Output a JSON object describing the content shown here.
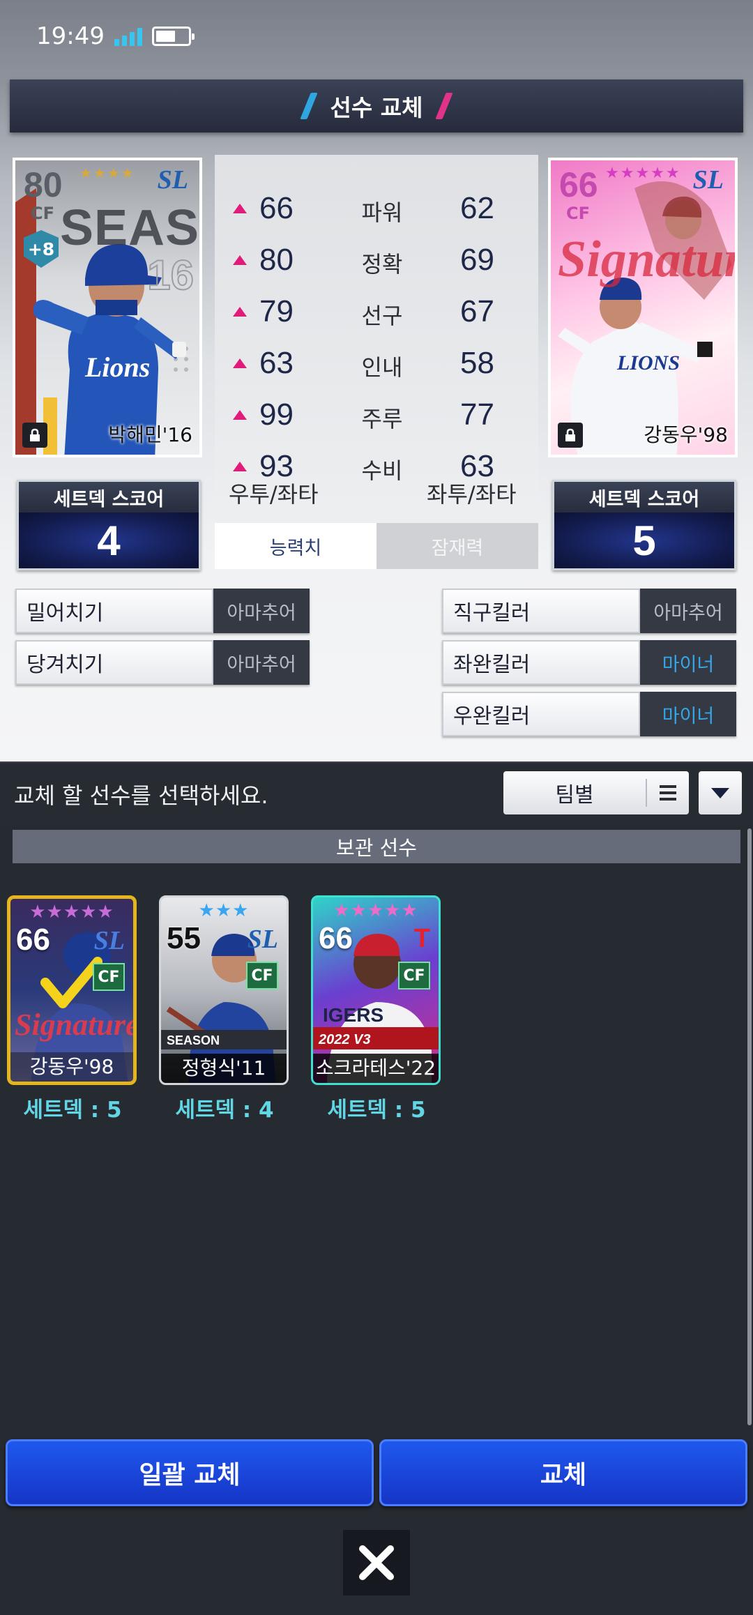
{
  "status_bar": {
    "time": "19:49"
  },
  "title": "선수 교체",
  "current_player": {
    "overall": "80",
    "position": "CF",
    "stars": "★★★★",
    "team_logo": "SL",
    "card_theme": "SEASON",
    "jersey_number": "16",
    "upgrade": "+8",
    "name": "박해민'16",
    "lock_icon": "lock-icon"
  },
  "target_player": {
    "overall": "66",
    "position": "CF",
    "stars": "★★★★★",
    "team_logo": "SL",
    "name": "강동우'98",
    "lock_icon": "lock-icon"
  },
  "stats": [
    {
      "label": "파워",
      "left": "66",
      "right": "62"
    },
    {
      "label": "정확",
      "left": "80",
      "right": "69"
    },
    {
      "label": "선구",
      "left": "79",
      "right": "67"
    },
    {
      "label": "인내",
      "left": "63",
      "right": "58"
    },
    {
      "label": "주루",
      "left": "99",
      "right": "77"
    },
    {
      "label": "수비",
      "left": "93",
      "right": "63"
    }
  ],
  "handedness": {
    "left": "우투/좌타",
    "right": "좌투/좌타"
  },
  "tabs": {
    "ability": "능력치",
    "potential": "잠재력"
  },
  "setdeck": {
    "label": "세트덱 스코어",
    "left_score": "4",
    "right_score": "5"
  },
  "left_skills": [
    {
      "name": "밀어치기",
      "level": "아마추어"
    },
    {
      "name": "당겨치기",
      "level": "아마추어"
    }
  ],
  "right_skills": [
    {
      "name": "직구킬러",
      "level": "아마추어"
    },
    {
      "name": "좌완킬러",
      "level": "마이너"
    },
    {
      "name": "우완킬러",
      "level": "마이너"
    }
  ],
  "select_message": "교체 할 선수를 선택하세요.",
  "sort": {
    "label": "팀별"
  },
  "storage_header": "보관 선수",
  "storage_cards": [
    {
      "overall": "66",
      "stars": "★★★★★",
      "position": "CF",
      "team": "SL",
      "name": "강동우'98",
      "deck": "세트덱 : 5",
      "selected": true
    },
    {
      "overall": "55",
      "stars": "★★★",
      "position": "CF",
      "team": "SL",
      "name": "정형식'11",
      "deck": "세트덱 : 4",
      "badge": "SEASON"
    },
    {
      "overall": "66",
      "stars": "★★★★★",
      "position": "CF",
      "team": "T",
      "name": "소크라테스'22",
      "deck": "세트덱 : 5",
      "badge": "2022 V3",
      "jersey_text": "IGERS"
    }
  ],
  "buttons": {
    "bulk_replace": "일괄 교체",
    "replace": "교체"
  },
  "colors": {
    "accent_blue": "#1f58ee",
    "up_arrow": "#e11b79",
    "minor": "#35a6e8",
    "deck_label": "#63d6e6"
  }
}
